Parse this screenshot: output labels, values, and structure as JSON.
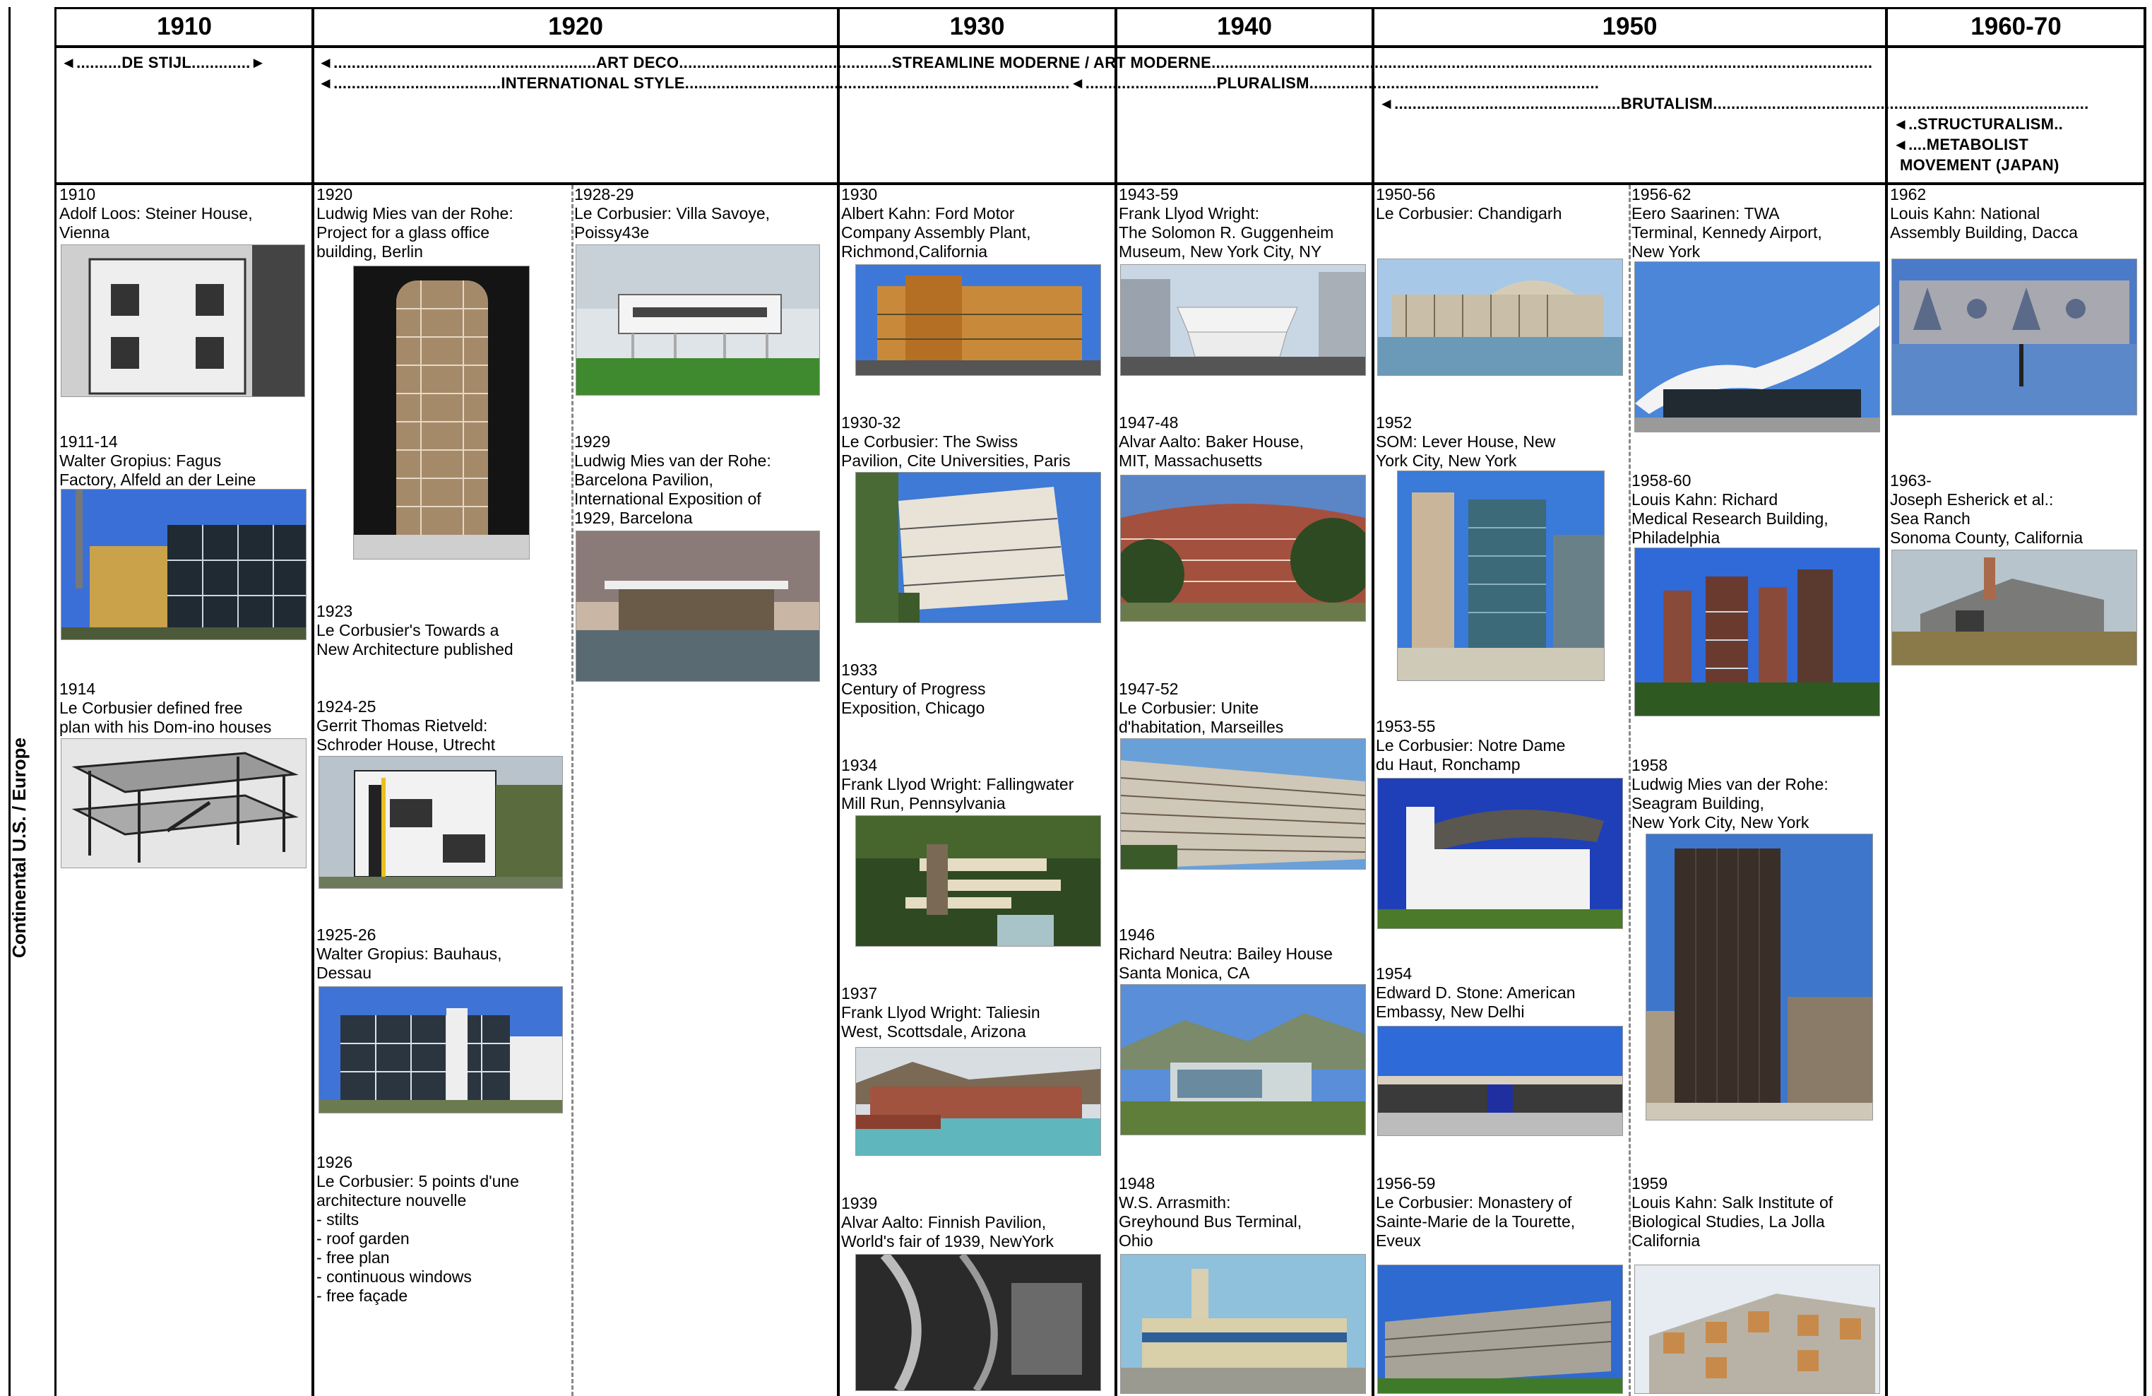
{
  "decades": [
    "1910",
    "1920",
    "1930",
    "1940",
    "1950",
    "1960-70"
  ],
  "side_label": "Continental U.S. / Europe",
  "movements": [
    {
      "text": "◄..........DE STIJL.............►"
    },
    {
      "text": "◄..........................................................ART DECO...............................................STREAMLINE MODERNE / ART MODERNE.................................................................................................................................................."
    },
    {
      "text": "◄.....................................INTERNATIONAL STYLE.....................................................................................◄.............................PLURALISM................................................................"
    },
    {
      "text": "◄..................................................BRUTALISM..................................................................................."
    },
    {
      "text": "◄..STRUCTURALISM.."
    },
    {
      "text": "◄....METABOLIST"
    },
    {
      "text": "MOVEMENT (JAPAN)"
    }
  ],
  "entries": [
    {
      "year": "1910",
      "title": "Adolf Loos: Steiner House,\nVienna",
      "image": "steiner-house-photo"
    },
    {
      "year": "1911-14",
      "title": "Walter Gropius: Fagus\nFactory, Alfeld an der Leine",
      "image": "fagus-factory-photo"
    },
    {
      "year": "1914",
      "title": "Le Corbusier defined free\nplan with his Dom-ino houses",
      "image": "dom-ino-house-photo"
    },
    {
      "year": "1920",
      "title": "Ludwig Mies van der Rohe:\nProject for a glass office\nbuilding, Berlin",
      "image": "glass-office-photo"
    },
    {
      "year": "1923",
      "title": "Le Corbusier's Towards a\nNew Architecture published"
    },
    {
      "year": "1924-25",
      "title": "Gerrit Thomas Rietveld:\nSchroder House, Utrecht",
      "image": "schroder-house-photo"
    },
    {
      "year": "1925-26",
      "title": "Walter Gropius: Bauhaus,\nDessau",
      "image": "bauhaus-photo"
    },
    {
      "year": "1926",
      "title": "Le Corbusier: 5 points d'une\narchitecture nouvelle",
      "list": [
        "stilts",
        "roof garden",
        "free plan",
        "continuous windows",
        "free façade"
      ]
    },
    {
      "year": "1928-29",
      "title": "Le Corbusier: Villa Savoye,\nPoissy43e",
      "image": "villa-savoye-photo"
    },
    {
      "year": "1929",
      "title": "Ludwig Mies van der Rohe:\nBarcelona Pavilion,\nInternational Exposition of\n1929, Barcelona",
      "image": "barcelona-pavilion-photo"
    },
    {
      "year": "1930",
      "title": "Albert Kahn: Ford Motor\nCompany Assembly Plant,\nRichmond,California",
      "image": "ford-plant-photo"
    },
    {
      "year": "1930-32",
      "title": "Le Corbusier: The Swiss\nPavilion, Cite Universities, Paris",
      "image": "swiss-pavilion-photo"
    },
    {
      "year": "1933",
      "title": "Century of Progress\nExposition, Chicago"
    },
    {
      "year": "1934",
      "title": "Frank Llyod Wright: Fallingwater\nMill Run, Pennsylvania",
      "image": "fallingwater-photo"
    },
    {
      "year": "1937",
      "title": "Frank Llyod Wright: Taliesin\nWest, Scottsdale, Arizona",
      "image": "taliesin-west-photo"
    },
    {
      "year": "1939",
      "title": "Alvar Aalto: Finnish Pavilion,\nWorld's fair of 1939, NewYork",
      "image": "finnish-pavilion-photo"
    },
    {
      "year": "1943-59",
      "title": "Frank Llyod Wright:\nThe Solomon R. Guggenheim\nMuseum, New York City, NY",
      "image": "guggenheim-photo"
    },
    {
      "year": "1947-48",
      "title": "Alvar Aalto: Baker House,\nMIT, Massachusetts",
      "image": "baker-house-photo"
    },
    {
      "year": "1947-52",
      "title": "Le Corbusier: Unite\nd'habitation, Marseilles",
      "image": "unite-habitation-photo"
    },
    {
      "year": "1946",
      "title": "Richard Neutra: Bailey House\nSanta Monica, CA",
      "image": "bailey-house-photo"
    },
    {
      "year": "1948",
      "title": "W.S. Arrasmith:\nGreyhound Bus Terminal,\nOhio",
      "image": "greyhound-terminal-photo"
    },
    {
      "year": "1950-56",
      "title": "Le Corbusier: Chandigarh",
      "image": "chandigarh-photo"
    },
    {
      "year": "1952",
      "title": "SOM: Lever House, New\nYork City, New York",
      "image": "lever-house-photo"
    },
    {
      "year": "1953-55",
      "title": "Le Corbusier: Notre Dame\ndu Haut, Ronchamp",
      "image": "ronchamp-photo"
    },
    {
      "year": "1954",
      "title": "Edward D. Stone: American\nEmbassy, New Delhi",
      "image": "american-embassy-photo"
    },
    {
      "year": "1956-59",
      "title": "Le Corbusier: Monastery of\nSainte-Marie de la Tourette,\nEveux",
      "image": "la-tourette-photo"
    },
    {
      "year": "1956-62",
      "title": "Eero Saarinen: TWA\nTerminal, Kennedy Airport,\nNew York",
      "image": "twa-terminal-photo"
    },
    {
      "year": "1958-60",
      "title": "Louis Kahn: Richard\nMedical Research Building,\nPhiladelphia",
      "image": "richards-building-photo"
    },
    {
      "year": "1958",
      "title": "Ludwig Mies van der Rohe:\nSeagram Building,\nNew York City, New York",
      "image": "seagram-building-photo"
    },
    {
      "year": "1959",
      "title": "Louis Kahn: Salk Institute of\nBiological Studies, La Jolla\nCalifornia",
      "image": "salk-institute-photo"
    },
    {
      "year": "1962",
      "title": "Louis Kahn: National\nAssembly Building, Dacca",
      "image": "national-assembly-photo"
    },
    {
      "year": "1963-",
      "title": "Joseph Esherick et al.:\nSea Ranch\nSonoma County, California",
      "image": "sea-ranch-photo"
    }
  ]
}
